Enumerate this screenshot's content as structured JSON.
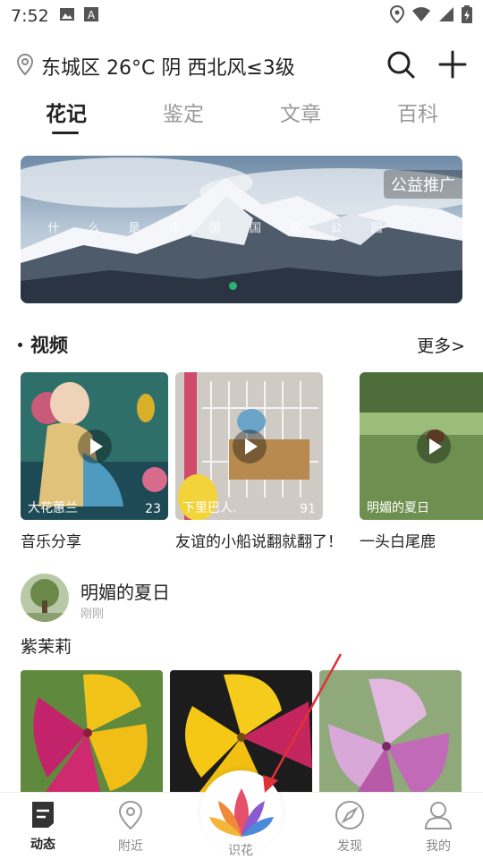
{
  "status_bar": {
    "time": "7:52"
  },
  "location_bar": {
    "text": "东城区 26°C 阴 西北风≤3级"
  },
  "tabs": [
    {
      "label": "花记",
      "active": true
    },
    {
      "label": "鉴定",
      "active": false
    },
    {
      "label": "文章",
      "active": false
    },
    {
      "label": "百科",
      "active": false
    }
  ],
  "banner": {
    "badge": "公益推广",
    "caption": "什 么 是 中 国 国 家 公 园 ？",
    "indicator_color": "#2bb36f"
  },
  "video_section": {
    "title": "视频",
    "more": "更多>"
  },
  "videos": [
    {
      "author": "大花蕙兰",
      "count": "23",
      "title": "音乐分享"
    },
    {
      "author": "下里巴人.",
      "count": "91",
      "title": "友谊的小船说翻就翻了！"
    },
    {
      "author": "明媚的夏日",
      "count": "",
      "title": "一头白尾鹿"
    }
  ],
  "post": {
    "author": "明媚的夏日",
    "time": "刚刚",
    "text": "紫茉莉"
  },
  "bottom_nav": [
    {
      "label": "动态",
      "icon": "feed-icon",
      "active": true
    },
    {
      "label": "附近",
      "icon": "location-pin-icon",
      "active": false
    },
    {
      "label": "识花",
      "icon": "lotus-icon",
      "active": false
    },
    {
      "label": "发现",
      "icon": "compass-icon",
      "active": false
    },
    {
      "label": "我的",
      "icon": "person-icon",
      "active": false
    }
  ],
  "colors": {
    "accent": "#2bb36f",
    "text": "#222222",
    "muted": "#888888",
    "annotation": "#e0303a"
  }
}
